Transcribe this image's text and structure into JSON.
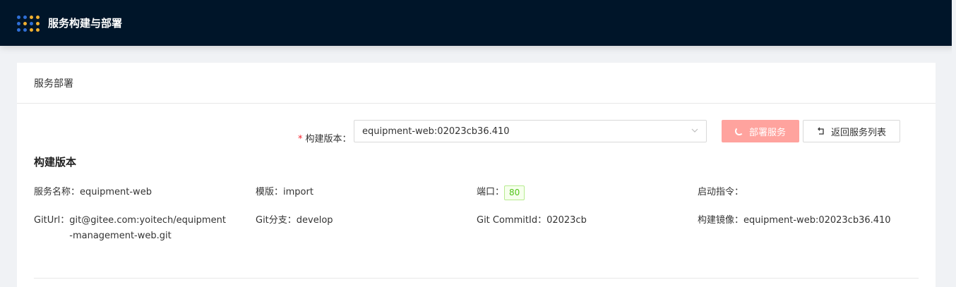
{
  "app": {
    "title": "服务构建与部署"
  },
  "card": {
    "title": "服务部署"
  },
  "form": {
    "label": "构建版本：",
    "required_mark": "*",
    "selected_version": "equipment-web:02023cb36.410",
    "deploy_label": "部署服务",
    "back_label": "返回服务列表"
  },
  "section": {
    "title": "构建版本"
  },
  "details": {
    "service_name_label": "服务名称：",
    "service_name": "equipment-web",
    "template_label": "模版：",
    "template": "import",
    "port_label": "端口：",
    "port": "80",
    "start_cmd_label": "启动指令：",
    "start_cmd": "",
    "git_url_label": "GitUrl：",
    "git_url": "git@gitee.com:yoitech/equipment-management-web.git",
    "git_branch_label": "Git分支：",
    "git_branch": "develop",
    "commit_label": "Git CommitId：",
    "commit": "02023cb",
    "image_label": "构建镜像：",
    "image": "equipment-web:02023cb36.410"
  },
  "colors": {
    "header_bg": "#001529",
    "deploy_button": "#ffa39e",
    "required": "#f5222d",
    "tag_green": "#52c41a"
  }
}
